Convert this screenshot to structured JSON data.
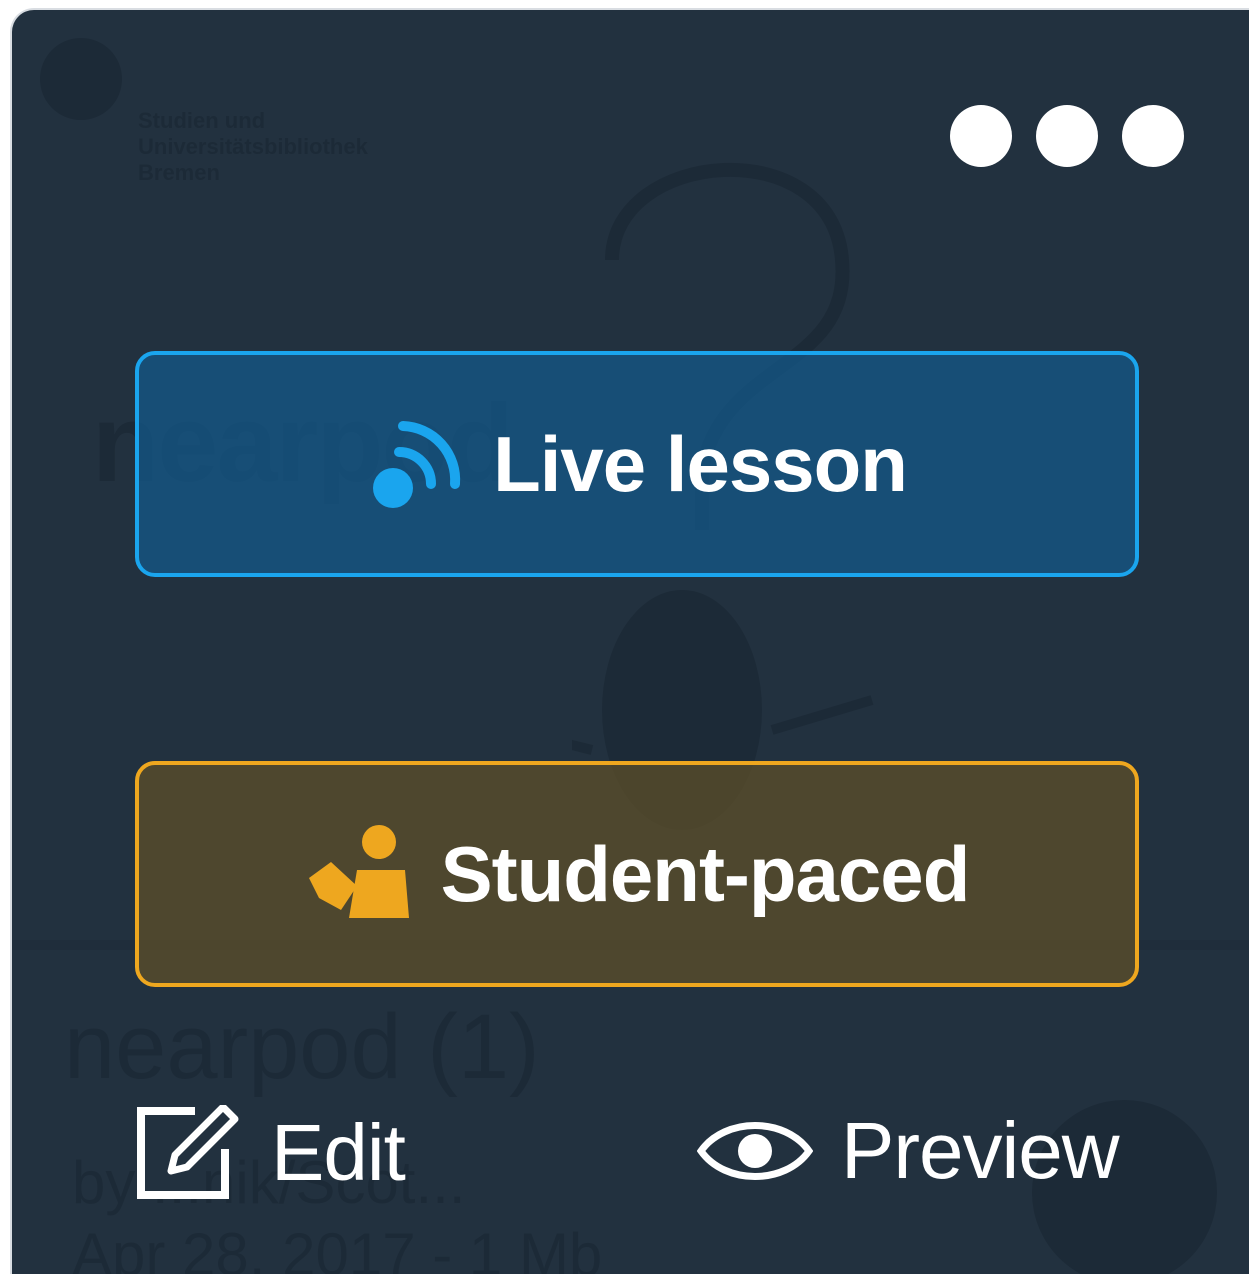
{
  "background": {
    "brand": "nearpod",
    "title": "nearpod (1)",
    "meta_line1": "by ...nik/Scot...",
    "meta_line2": "Apr 28, 2017 - 1 Mb",
    "logo_text": "Studien und Universitätsbibliothek Bremen"
  },
  "card": {
    "more_menu_icon": "more-horizontal-icon"
  },
  "modes": {
    "live": {
      "label": "Live lesson",
      "icon": "live-broadcast-icon",
      "accent": "#1aa5ee"
    },
    "student_paced": {
      "label": "Student-paced",
      "icon": "student-reading-icon",
      "accent": "#eea71f"
    }
  },
  "actions": {
    "edit": {
      "label": "Edit",
      "icon": "edit-icon"
    },
    "preview": {
      "label": "Preview",
      "icon": "eye-icon"
    }
  },
  "colors": {
    "card_background": "#22313f",
    "text": "#ffffff"
  }
}
